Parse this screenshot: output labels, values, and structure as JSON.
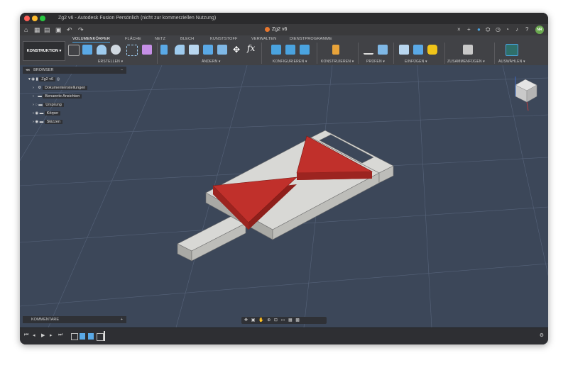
{
  "window": {
    "title": "Zg2 v6 - Autodesk Fusion Persönlich (nicht zur kommerziellen Nutzung)",
    "document_tab": "Zg2 v6",
    "user_initials": "NR"
  },
  "ribbon": {
    "workspace": "KONSTRUKTION",
    "tabs": [
      "VOLUMENKÖRPER",
      "FLÄCHE",
      "NETZ",
      "BLECH",
      "KUNSTSTOFF",
      "VERWALTEN",
      "DIENSTPROGRAMME"
    ],
    "active_tab": "VOLUMENKÖRPER",
    "groups": [
      "ERSTELLEN ▾",
      "ÄNDERN ▾",
      "KONFIGURIEREN ▾",
      "KONSTRUIEREN ▾",
      "PRÜFEN ▾",
      "EINFÜGEN ▾",
      "ZUSAMMENFÜGEN ▾",
      "AUSWÄHLEN ▾"
    ]
  },
  "browser": {
    "header": "BROWSER",
    "root": "Zg2 v6",
    "items": [
      "Dokumenteinstellungen",
      "Benannte Ansichten",
      "Ursprung",
      "Körper",
      "Skizzen"
    ]
  },
  "comments": {
    "header": "KOMMENTARE",
    "add": "+"
  },
  "colors": {
    "viewport": "#3c4759",
    "part_top": "#d8d8d5",
    "part_side": "#a9a9a5",
    "bowtie": "#c0302b",
    "accent": "#4aa3df"
  }
}
